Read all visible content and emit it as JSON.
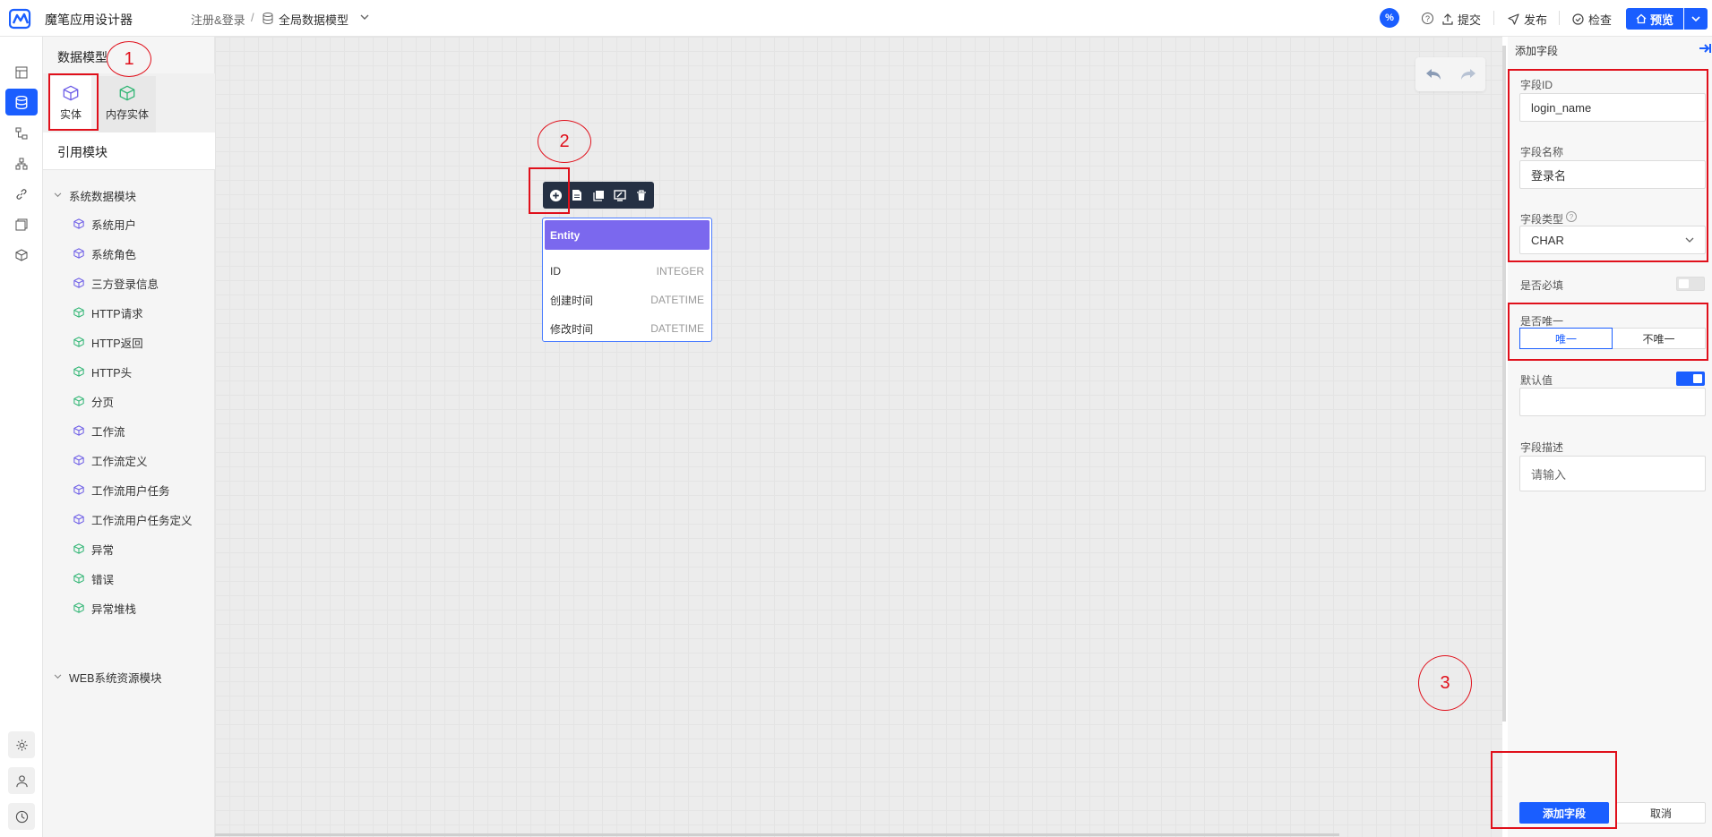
{
  "app": {
    "title": "魔笔应用设计器"
  },
  "breadcrumb": {
    "item1": "注册&登录",
    "sep": "/",
    "item2": "全局数据模型"
  },
  "header": {
    "percent": "%",
    "help": "?",
    "submit": "提交",
    "publish": "发布",
    "check": "检查",
    "preview": "预览"
  },
  "panel": {
    "title": "数据模型",
    "tabs": [
      {
        "label": "实体"
      },
      {
        "label": "内存实体"
      }
    ],
    "section": "引用模块",
    "groups": [
      {
        "label": "系统数据模块",
        "items": [
          {
            "label": "系统用户",
            "kind": "entity"
          },
          {
            "label": "系统角色",
            "kind": "entity"
          },
          {
            "label": "三方登录信息",
            "kind": "entity"
          },
          {
            "label": "HTTP请求",
            "kind": "memory"
          },
          {
            "label": "HTTP返回",
            "kind": "memory"
          },
          {
            "label": "HTTP头",
            "kind": "memory"
          },
          {
            "label": "分页",
            "kind": "memory"
          },
          {
            "label": "工作流",
            "kind": "entity"
          },
          {
            "label": "工作流定义",
            "kind": "entity"
          },
          {
            "label": "工作流用户任务",
            "kind": "entity"
          },
          {
            "label": "工作流用户任务定义",
            "kind": "entity"
          },
          {
            "label": "异常",
            "kind": "memory"
          },
          {
            "label": "错误",
            "kind": "memory"
          },
          {
            "label": "异常堆栈",
            "kind": "memory"
          }
        ]
      },
      {
        "label": "WEB系统资源模块",
        "items": []
      }
    ]
  },
  "entity": {
    "title": "Entity",
    "fields": [
      {
        "name": "ID",
        "type": "INTEGER"
      },
      {
        "name": "创建时间",
        "type": "DATETIME"
      },
      {
        "name": "修改时间",
        "type": "DATETIME"
      }
    ]
  },
  "form": {
    "title": "添加字段",
    "field_id_label": "字段ID",
    "field_id_value": "login_name",
    "field_name_label": "字段名称",
    "field_name_value": "登录名",
    "field_type_label": "字段类型",
    "field_type_value": "CHAR",
    "required_label": "是否必填",
    "unique_label": "是否唯一",
    "unique_option": "唯一",
    "not_unique_option": "不唯一",
    "default_label": "默认值",
    "default_value": "",
    "desc_label": "字段描述",
    "desc_placeholder": "请输入",
    "add_button": "添加字段",
    "cancel_button": "取消"
  },
  "annotations": [
    "1",
    "2",
    "3"
  ],
  "colors": {
    "primary": "#1a5eff",
    "entity_header": "#7b68ee",
    "annotation": "#e0101b",
    "memory_icon": "#2fb573"
  }
}
